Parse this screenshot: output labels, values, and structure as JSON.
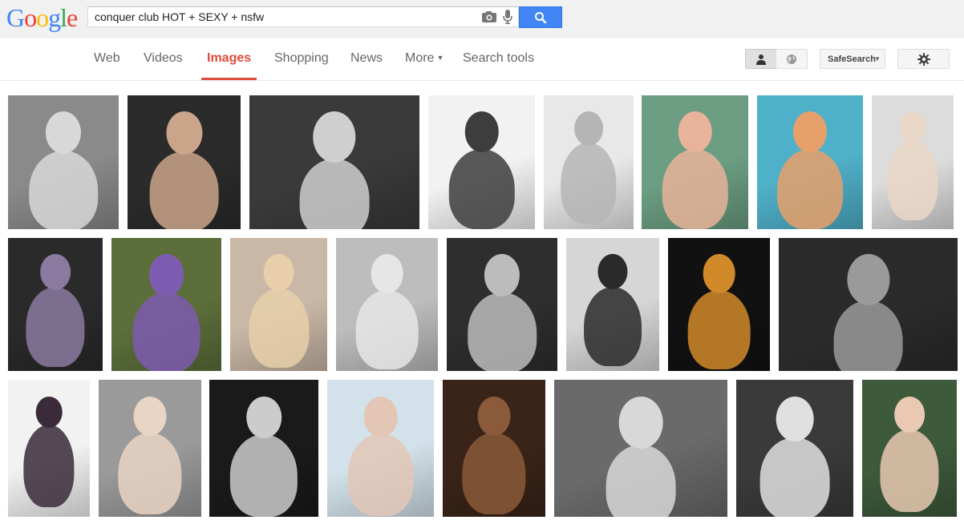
{
  "header": {
    "logo_letters": [
      {
        "ch": "G",
        "color": "#4285f4"
      },
      {
        "ch": "o",
        "color": "#ea4335"
      },
      {
        "ch": "o",
        "color": "#fbbc05"
      },
      {
        "ch": "g",
        "color": "#4285f4"
      },
      {
        "ch": "l",
        "color": "#34a853"
      },
      {
        "ch": "e",
        "color": "#ea4335"
      }
    ],
    "search_query": "conquer club HOT + SEXY + nsfw"
  },
  "nav": {
    "tabs": [
      {
        "label": "Web",
        "active": false
      },
      {
        "label": "Videos",
        "active": false
      },
      {
        "label": "Images",
        "active": true
      },
      {
        "label": "Shopping",
        "active": false
      },
      {
        "label": "News",
        "active": false
      },
      {
        "label": "More",
        "active": false
      },
      {
        "label": "Search tools",
        "active": false
      }
    ],
    "safesearch_label": "SafeSearch",
    "accent_color": "#dd4b39",
    "search_button_color": "#4285f4"
  },
  "results": {
    "thumbnails": [
      {
        "tone": "bw",
        "bg": "#8a8a8a",
        "fg": "#d8d8d8"
      },
      {
        "tone": "color",
        "bg": "#2b2b2b",
        "fg": "#caa58a"
      },
      {
        "tone": "bw",
        "bg": "#3a3a3a",
        "fg": "#cfcfcf"
      },
      {
        "tone": "bw",
        "bg": "#f2f2f2",
        "fg": "#3d3d3d"
      },
      {
        "tone": "bw",
        "bg": "#e8e8e8",
        "fg": "#b5b5b5"
      },
      {
        "tone": "color",
        "bg": "#6b9e82",
        "fg": "#e8b39a"
      },
      {
        "tone": "color",
        "bg": "#4fb0c9",
        "fg": "#e8a06a"
      },
      {
        "tone": "color",
        "bg": "#dcdcdc",
        "fg": "#e9d7c7"
      },
      {
        "tone": "color",
        "bg": "#2a2a2a",
        "fg": "#8a7aa0"
      },
      {
        "tone": "color",
        "bg": "#5c6f3a",
        "fg": "#7d5bb0"
      },
      {
        "tone": "color",
        "bg": "#c9b8a6",
        "fg": "#e8cfaa"
      },
      {
        "tone": "bw",
        "bg": "#bdbdbd",
        "fg": "#e6e6e6"
      },
      {
        "tone": "bw",
        "bg": "#2e2e2e",
        "fg": "#bcbcbc"
      },
      {
        "tone": "bw",
        "bg": "#d6d6d6",
        "fg": "#2a2a2a"
      },
      {
        "tone": "color",
        "bg": "#111111",
        "fg": "#d08a2a"
      },
      {
        "tone": "bw",
        "bg": "#2b2b2b",
        "fg": "#9a9a9a"
      },
      {
        "tone": "color",
        "bg": "#f2f2f2",
        "fg": "#3a2a3a"
      },
      {
        "tone": "color",
        "bg": "#9a9a9a",
        "fg": "#e9d5c3"
      },
      {
        "tone": "bw",
        "bg": "#1a1a1a",
        "fg": "#cccccc"
      },
      {
        "tone": "color",
        "bg": "#d3e2ea",
        "fg": "#e3c6b6"
      },
      {
        "tone": "color",
        "bg": "#3a2418",
        "fg": "#8a5a3a"
      },
      {
        "tone": "bw",
        "bg": "#6a6a6a",
        "fg": "#d8d8d8"
      },
      {
        "tone": "bw",
        "bg": "#3a3a3a",
        "fg": "#e0e0e0"
      },
      {
        "tone": "color",
        "bg": "#3d5a3a",
        "fg": "#e9c9b1"
      }
    ]
  }
}
